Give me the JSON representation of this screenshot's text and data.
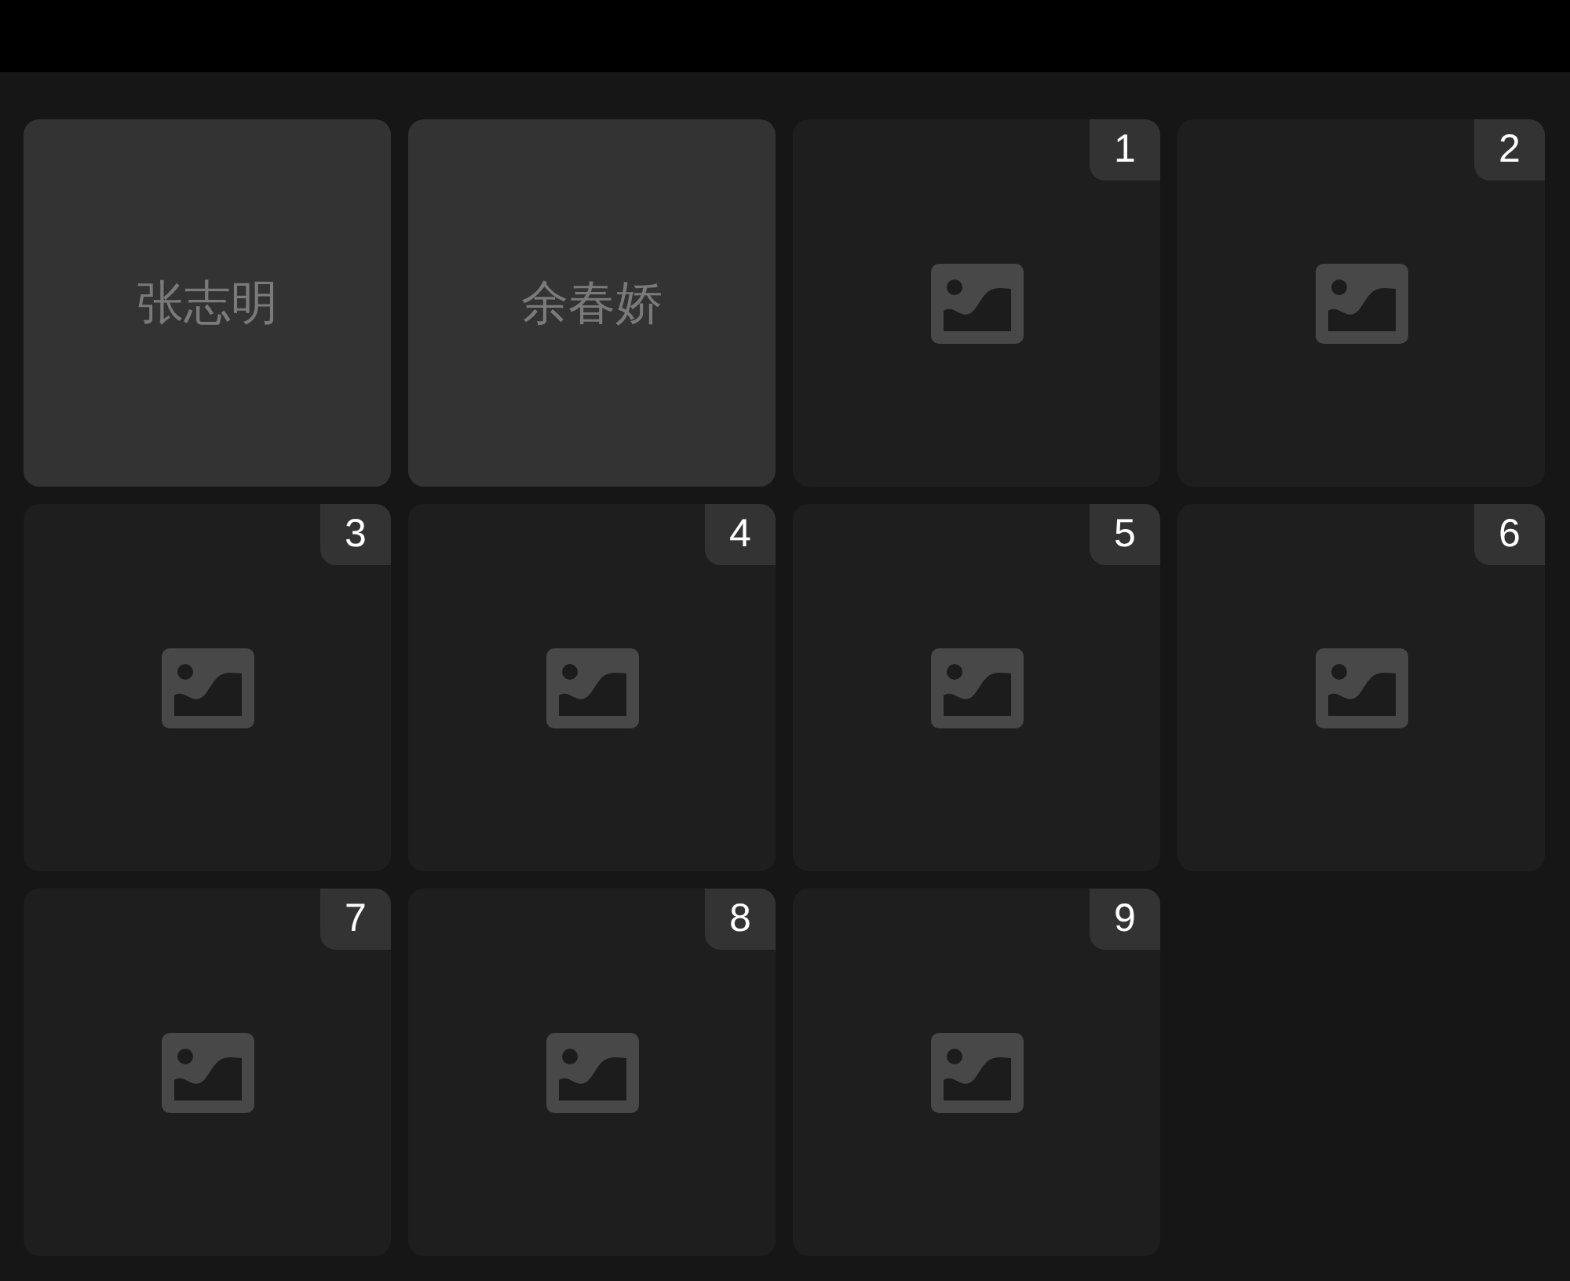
{
  "tiles": [
    {
      "kind": "name",
      "label": "张志明"
    },
    {
      "kind": "name",
      "label": "余春娇"
    },
    {
      "kind": "image",
      "badge": "1"
    },
    {
      "kind": "image",
      "badge": "2"
    },
    {
      "kind": "image",
      "badge": "3"
    },
    {
      "kind": "image",
      "badge": "4"
    },
    {
      "kind": "image",
      "badge": "5"
    },
    {
      "kind": "image",
      "badge": "6"
    },
    {
      "kind": "image",
      "badge": "7"
    },
    {
      "kind": "image",
      "badge": "8"
    },
    {
      "kind": "image",
      "badge": "9"
    }
  ]
}
